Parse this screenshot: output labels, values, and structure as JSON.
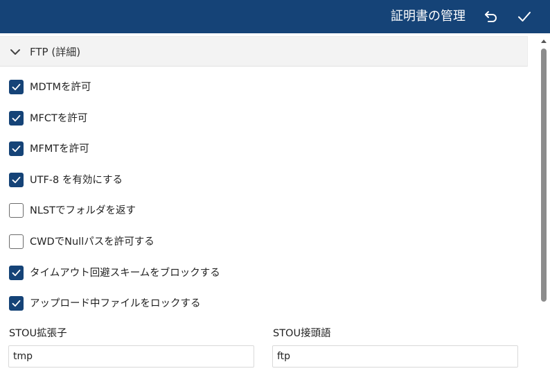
{
  "header": {
    "title": "証明書の管理",
    "bg_color": "#154377"
  },
  "section": {
    "title": "FTP (詳細)"
  },
  "checkboxes": [
    {
      "label": "MDTMを許可",
      "checked": true
    },
    {
      "label": "MFCTを許可",
      "checked": true
    },
    {
      "label": "MFMTを許可",
      "checked": true
    },
    {
      "label": "UTF-8 を有効にする",
      "checked": true
    },
    {
      "label": "NLSTでフォルダを返す",
      "checked": false
    },
    {
      "label": "CWDでNullパスを許可する",
      "checked": false
    },
    {
      "label": "タイムアウト回避スキームをブロックする",
      "checked": true
    },
    {
      "label": "アップロード中ファイルをロックする",
      "checked": true
    }
  ],
  "fields": {
    "stou_ext": {
      "label": "STOU拡張子",
      "value": "tmp"
    },
    "stou_prefix": {
      "label": "STOU接頭語",
      "value": "ftp"
    }
  },
  "icons": {
    "undo": "undo-icon",
    "confirm": "check-icon",
    "collapse": "chevron-down-icon"
  },
  "colors": {
    "accent": "#154377"
  }
}
